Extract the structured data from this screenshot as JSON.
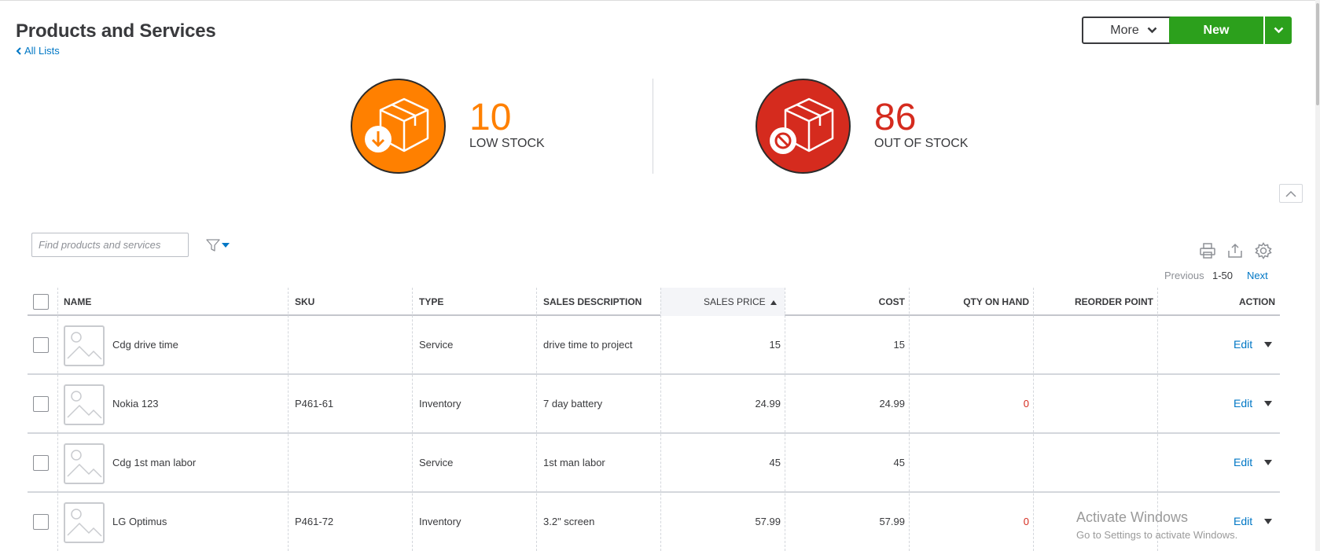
{
  "header": {
    "title": "Products and Services",
    "back_link": "All Lists",
    "more_label": "More",
    "new_label": "New"
  },
  "summary": {
    "low_stock": {
      "count": "10",
      "label": "LOW STOCK",
      "color": "#ff8000"
    },
    "out_of_stock": {
      "count": "86",
      "label": "OUT OF STOCK",
      "color": "#d52b1e"
    }
  },
  "toolbar": {
    "search_placeholder": "Find products and services",
    "pager": {
      "previous": "Previous",
      "range": "1-50",
      "next": "Next"
    },
    "icons": [
      "print-icon",
      "export-icon",
      "settings-icon"
    ]
  },
  "table": {
    "columns": [
      "NAME",
      "SKU",
      "TYPE",
      "SALES DESCRIPTION",
      "SALES PRICE",
      "COST",
      "QTY ON HAND",
      "REORDER POINT",
      "ACTION"
    ],
    "sorted_column": "SALES PRICE",
    "rows": [
      {
        "name": "Cdg drive time",
        "sku": "",
        "type": "Service",
        "description": "drive time to project",
        "price": "15",
        "cost": "15",
        "qty": "",
        "reorder": "",
        "action": "Edit"
      },
      {
        "name": "Nokia 123",
        "sku": "P461-61",
        "type": "Inventory",
        "description": "7 day battery",
        "price": "24.99",
        "cost": "24.99",
        "qty": "0",
        "reorder": "",
        "action": "Edit"
      },
      {
        "name": "Cdg 1st man labor",
        "sku": "",
        "type": "Service",
        "description": "1st man labor",
        "price": "45",
        "cost": "45",
        "qty": "",
        "reorder": "",
        "action": "Edit"
      },
      {
        "name": "LG Optimus",
        "sku": "P461-72",
        "type": "Inventory",
        "description": "3.2\" screen",
        "price": "57.99",
        "cost": "57.99",
        "qty": "0",
        "reorder": "",
        "action": "Edit"
      }
    ]
  },
  "watermark": {
    "title": "Activate Windows",
    "subtitle": "Go to Settings to activate Windows."
  }
}
